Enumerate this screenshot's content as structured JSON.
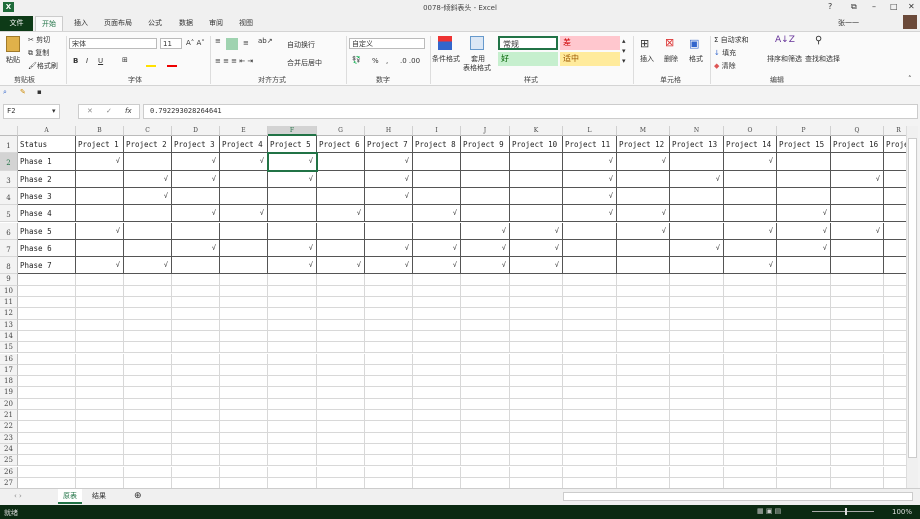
{
  "window": {
    "title": "0078-倾斜表头 - Excel",
    "user": "张一一",
    "controls": [
      "?",
      "⧉",
      "–",
      "□",
      "✕"
    ]
  },
  "tabs": [
    {
      "label": "文件"
    },
    {
      "label": "开始"
    },
    {
      "label": "插入"
    },
    {
      "label": "页面布局"
    },
    {
      "label": "公式"
    },
    {
      "label": "数据"
    },
    {
      "label": "审阅"
    },
    {
      "label": "视图"
    }
  ],
  "ribbon": {
    "clipboard": {
      "paste": "粘贴",
      "cut": "剪切",
      "copy": "复制",
      "format_painter": "格式刷",
      "label": "剪贴板"
    },
    "font": {
      "name": "宋体",
      "size": "11",
      "bold": "B",
      "italic": "I",
      "underline": "U",
      "label": "字体"
    },
    "alignment": {
      "wrap": "自动换行",
      "merge": "合并后居中",
      "label": "对齐方式"
    },
    "number": {
      "format": "自定义",
      "percent": "%",
      "comma": ",",
      "label": "数字"
    },
    "styles": {
      "conditional": "条件格式",
      "table_format_1": "套用",
      "table_format_2": "表格格式",
      "normal": "常规",
      "bad": "差",
      "good": "好",
      "neutral": "适中",
      "label": "样式"
    },
    "cells": {
      "insert": "插入",
      "delete": "删除",
      "format": "格式",
      "label": "单元格"
    },
    "editing": {
      "autosum": "自动求和",
      "fill": "填充",
      "clear": "清除",
      "sort": "排序和筛选",
      "find": "查找和选择",
      "label": "编辑"
    }
  },
  "colors": {
    "accent": "#217346",
    "bad_bg": "#ffc7ce",
    "good_bg": "#c6efce",
    "neutral_bg": "#ffeb9c"
  },
  "formula_bar": {
    "name_box": "F2",
    "cancel": "✕",
    "enter": "✓",
    "fx": "fx",
    "value": "0.792293028264641"
  },
  "sheet": {
    "columns": [
      "A",
      "B",
      "C",
      "D",
      "E",
      "F",
      "G",
      "H",
      "I",
      "J",
      "K",
      "L",
      "M",
      "N",
      "O",
      "P",
      "Q",
      "R"
    ],
    "selected_column": "F",
    "selected_row": 2,
    "header_row": [
      "Status",
      "Project 1",
      "Project 2",
      "Project 3",
      "Project 4",
      "Project 5",
      "Project 6",
      "Project 7",
      "Project 8",
      "Project 9",
      "Project 10",
      "Project 11",
      "Project 12",
      "Project 13",
      "Project 14",
      "Project 15",
      "Project 16",
      "Proje"
    ],
    "check_mark": "√",
    "rows": [
      {
        "label": "Phase 1",
        "checks": [
          "B",
          "D",
          "E",
          "F",
          "H",
          "L",
          "M",
          "O"
        ]
      },
      {
        "label": "Phase 2",
        "checks": [
          "C",
          "D",
          "F",
          "H",
          "L",
          "N",
          "Q"
        ]
      },
      {
        "label": "Phase 3",
        "checks": [
          "C",
          "H",
          "L"
        ]
      },
      {
        "label": "Phase 4",
        "checks": [
          "D",
          "E",
          "G",
          "I",
          "L",
          "M",
          "P"
        ]
      },
      {
        "label": "Phase 5",
        "checks": [
          "B",
          "J",
          "K",
          "M",
          "O",
          "P",
          "Q"
        ]
      },
      {
        "label": "Phase 6",
        "checks": [
          "D",
          "F",
          "H",
          "I",
          "J",
          "K",
          "N",
          "P"
        ]
      },
      {
        "label": "Phase 7",
        "checks": [
          "B",
          "C",
          "F",
          "G",
          "H",
          "I",
          "J",
          "K",
          "O"
        ]
      }
    ],
    "row_numbers_visible": 29
  },
  "sheet_tabs": [
    {
      "label": "原表",
      "active": true
    },
    {
      "label": "结果",
      "active": false
    }
  ],
  "status": {
    "ready": "就绪",
    "zoom": "100%"
  }
}
